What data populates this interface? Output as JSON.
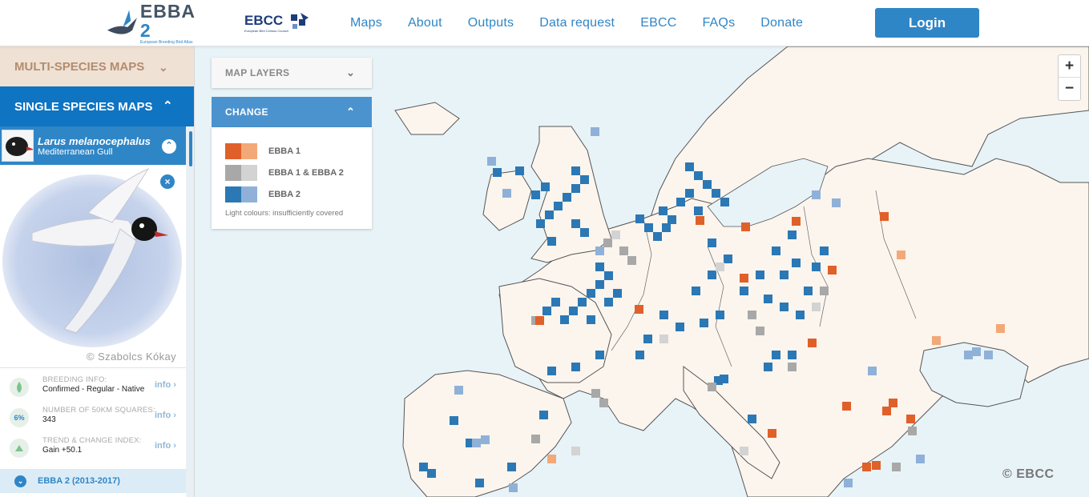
{
  "header": {
    "logo_title": "EBBA 2",
    "logo_subtitle": "European Breeding Bird Atlas",
    "partner_logo": "EBCC",
    "partner_subtitle": "European Bird Census Council",
    "nav": [
      "Maps",
      "About",
      "Outputs",
      "Data request",
      "EBCC",
      "FAQs",
      "Donate"
    ],
    "login_label": "Login"
  },
  "sidebar": {
    "multi_label": "MULTI-SPECIES MAPS",
    "single_label": "SINGLE SPECIES MAPS",
    "species": {
      "scientific": "Larus melanocephalus",
      "common": "Mediterranean Gull"
    },
    "photo_credit": "© Szabolcs Kókay",
    "info": [
      {
        "label": "BREEDING INFO:",
        "value": "Confirmed - Regular - Native",
        "icon": "droplet-icon",
        "icon_text": "",
        "more": "info ›"
      },
      {
        "label": "NUMBER OF 50KM SQUARES:",
        "value": "343",
        "icon": "percent-icon",
        "icon_text": "6%",
        "more": "info ›"
      },
      {
        "label": "TREND & CHANGE INDEX:",
        "value": "Gain +50.1",
        "icon": "trend-up-icon",
        "icon_text": "",
        "more": "info ›"
      }
    ],
    "ebba2_label": "EBBA 2 (2013-2017)"
  },
  "map": {
    "layers_label": "MAP LAYERS",
    "change_label": "CHANGE",
    "legend": [
      {
        "label": "EBBA 1",
        "dark": "#e0602a",
        "light": "#f3a877"
      },
      {
        "label": "EBBA 1 & EBBA 2",
        "dark": "#a8a8a8",
        "light": "#d3d3d3"
      },
      {
        "label": "EBBA 2",
        "dark": "#2b78b5",
        "light": "#8fb1d8"
      }
    ],
    "legend_note": "Light colours: insufficiently covered",
    "zoom_in": "+",
    "zoom_out": "−",
    "copyright": "© EBCC",
    "land_color": "#fbf5ee",
    "sea_color": "#e8f3f8"
  }
}
